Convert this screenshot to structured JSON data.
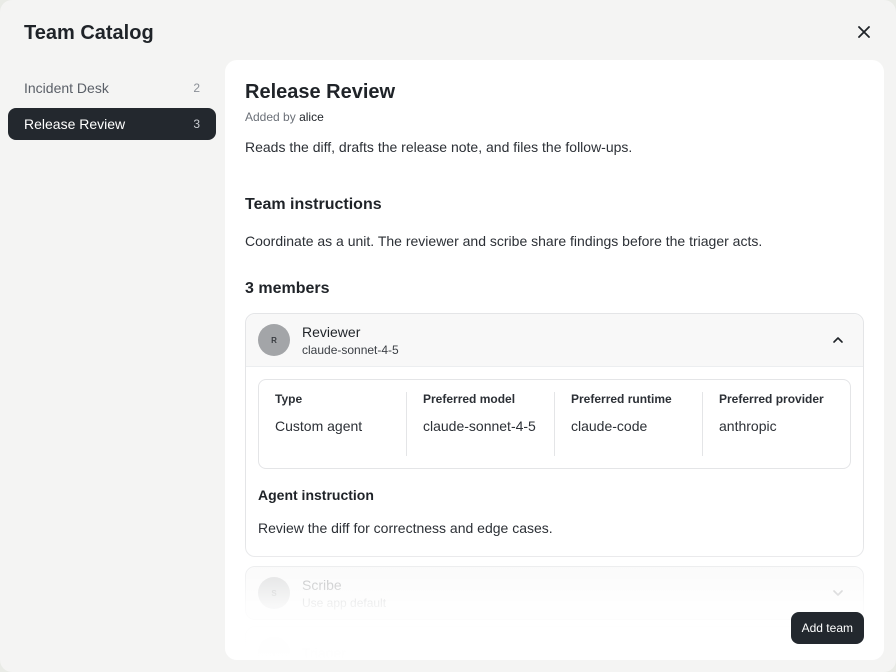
{
  "modal": {
    "title": "Team Catalog"
  },
  "sidebar": {
    "items": [
      {
        "label": "Incident Desk",
        "count": "2"
      },
      {
        "label": "Release Review",
        "count": "3"
      }
    ]
  },
  "team": {
    "name": "Release Review",
    "added_by_prefix": "Added by",
    "added_by_user": "alice",
    "description": "Reads the diff, drafts the release note, and files the follow-ups.",
    "instructions_title": "Team instructions",
    "instructions": "Coordinate as a unit. The reviewer and scribe share findings before the triager acts.",
    "members_title": "3 members"
  },
  "members": [
    {
      "initial": "R",
      "name": "Reviewer",
      "model": "claude-sonnet-4-5",
      "props": [
        {
          "label": "Type",
          "value": "Custom agent"
        },
        {
          "label": "Preferred model",
          "value": "claude-sonnet-4-5"
        },
        {
          "label": "Preferred runtime",
          "value": "claude-code"
        },
        {
          "label": "Preferred provider",
          "value": "anthropic"
        }
      ],
      "instruction_title": "Agent instruction",
      "instruction": "Review the diff for correctness and edge cases."
    },
    {
      "initial": "S",
      "name": "Scribe",
      "model": "Use app default"
    },
    {
      "initial": "T",
      "name": "Triager"
    }
  ],
  "actions": {
    "add_team": "Add team"
  },
  "icons": {
    "close": "close-icon",
    "collapse": "chevron-up-icon",
    "expand": "chevron-down-icon"
  }
}
